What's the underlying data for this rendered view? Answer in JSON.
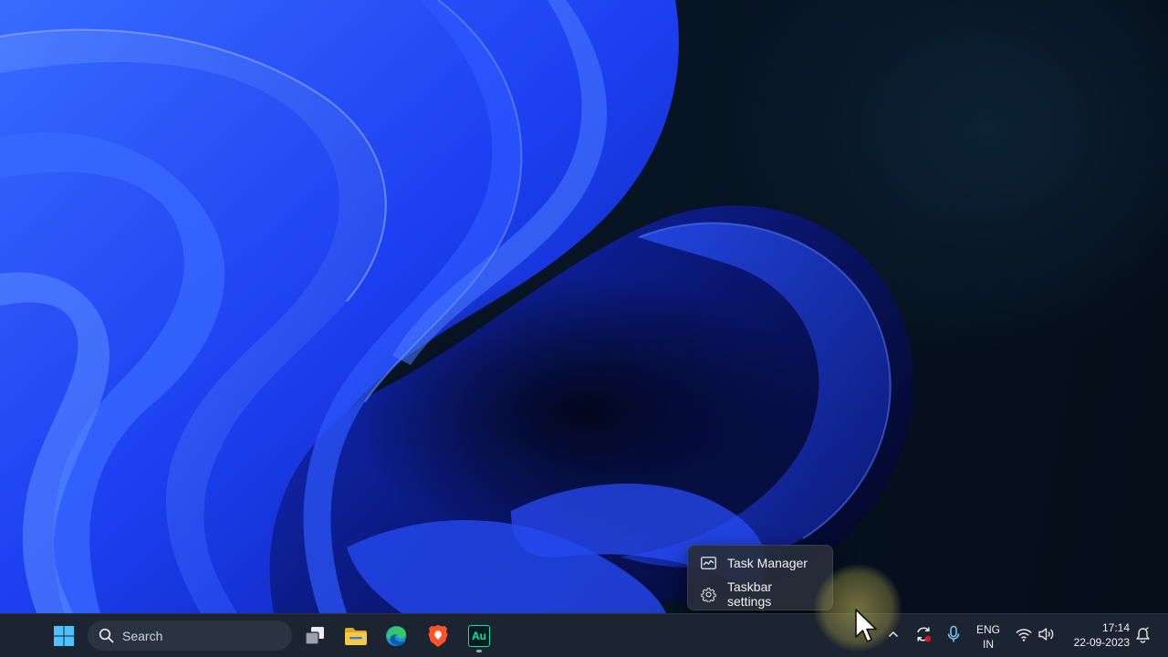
{
  "taskbar": {
    "search_placeholder": "Search",
    "apps": [
      {
        "name": "Task View",
        "icon": "task-view-icon"
      },
      {
        "name": "File Explorer",
        "icon": "folder-icon"
      },
      {
        "name": "Microsoft Edge",
        "icon": "edge-icon"
      },
      {
        "name": "Brave",
        "icon": "brave-icon"
      },
      {
        "name": "Audition",
        "icon": "audition-icon",
        "label": "Au",
        "active": true
      }
    ],
    "tray": {
      "language_line1": "ENG",
      "language_line2": "IN",
      "time": "17:14",
      "date": "22-09-2023"
    }
  },
  "context_menu": {
    "items": [
      {
        "label": "Task Manager",
        "icon": "task-manager-icon"
      },
      {
        "label": "Taskbar settings",
        "icon": "gear-icon"
      }
    ]
  },
  "colors": {
    "taskbar_bg": "#1c2431",
    "wallpaper_blue": "#1a3cff",
    "accent_blue": "#0067c0"
  }
}
